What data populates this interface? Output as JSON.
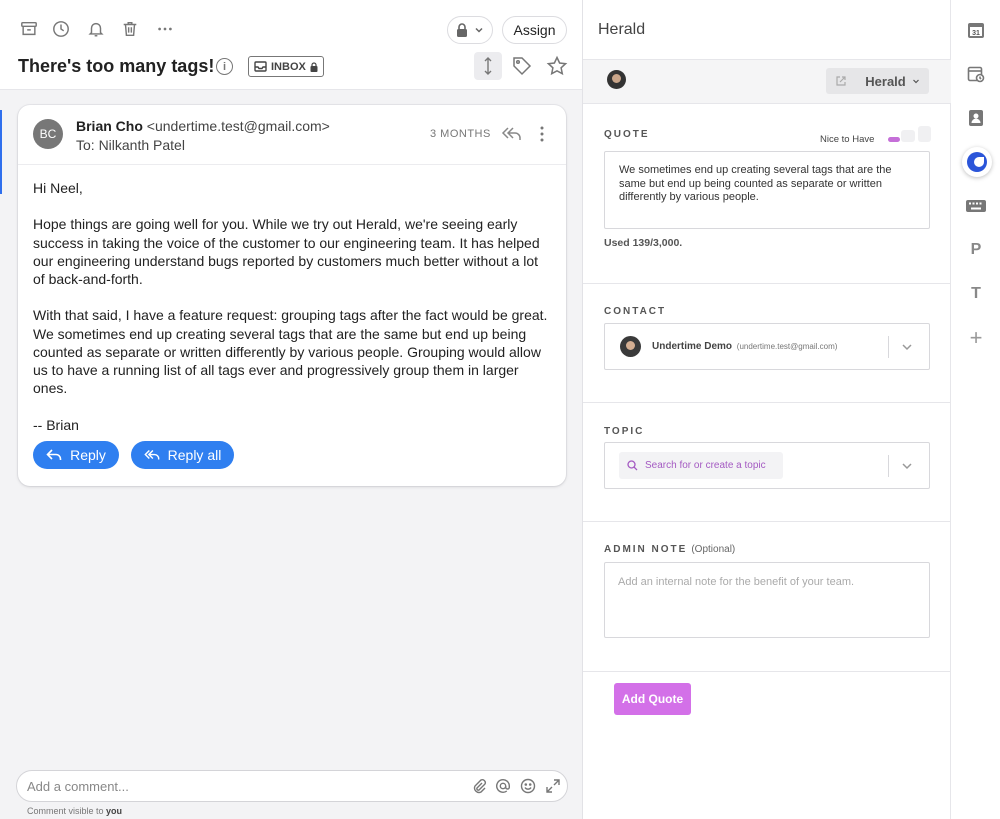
{
  "conversation": {
    "subject": "There's too many tags!",
    "info_glyph": "i",
    "inbox_badge": "INBOX",
    "assign_label": "Assign",
    "toolbar_icons": [
      "archive-icon",
      "clock-icon",
      "bell-icon",
      "trash-icon",
      "more-horizontal-icon"
    ]
  },
  "message": {
    "avatar_initials": "BC",
    "sender_name": "Brian Cho",
    "sender_email": "<undertime.test@gmail.com>",
    "to_line": "To: Nilkanth Patel",
    "time_ago": "3 MONTHS",
    "body": [
      "Hi Neel,",
      "Hope things are going well for you. While we try out Herald, we're seeing early success in taking the voice of the customer to our engineering team. It has helped our engineering understand bugs reported by customers much better without a lot of back-and-forth.",
      "With that said, I have a feature request: grouping tags after the fact would be great. We sometimes end up creating several tags that are the same but end up being counted as separate or written differently by various people. Grouping would allow us to have a running list of all tags ever and progressively group them in larger ones.",
      "-- Brian"
    ],
    "reply_label": "Reply",
    "reply_all_label": "Reply all"
  },
  "comment": {
    "placeholder": "Add a comment...",
    "note_prefix": "Comment visible to",
    "note_target": "you"
  },
  "herald": {
    "title": "Herald",
    "dropdown_label": "Herald",
    "quote_label": "QUOTE",
    "priority_label": "Nice to Have",
    "quote_text": "We sometimes end up creating several tags that are the same but end up being counted as separate or written differently by various people.",
    "used_text": "Used 139/3,000.",
    "contact_label": "CONTACT",
    "contact_name": "Undertime Demo",
    "contact_email": "(undertime.test@gmail.com)",
    "topic_label": "TOPIC",
    "topic_placeholder": "Search for or create a topic",
    "admin_note_label": "ADMIN NOTE",
    "admin_note_optional": "(Optional)",
    "admin_note_placeholder": "Add an internal note for the benefit of your team.",
    "add_quote_label": "Add Quote"
  },
  "rail": {
    "calendar_day": "31",
    "p_label": "P",
    "t_label": "T",
    "plus_label": "+"
  },
  "colors": {
    "accent_blue": "#2f7ff0",
    "herald_purple": "#d370e8",
    "topic_text_purple": "#a45ac2"
  }
}
